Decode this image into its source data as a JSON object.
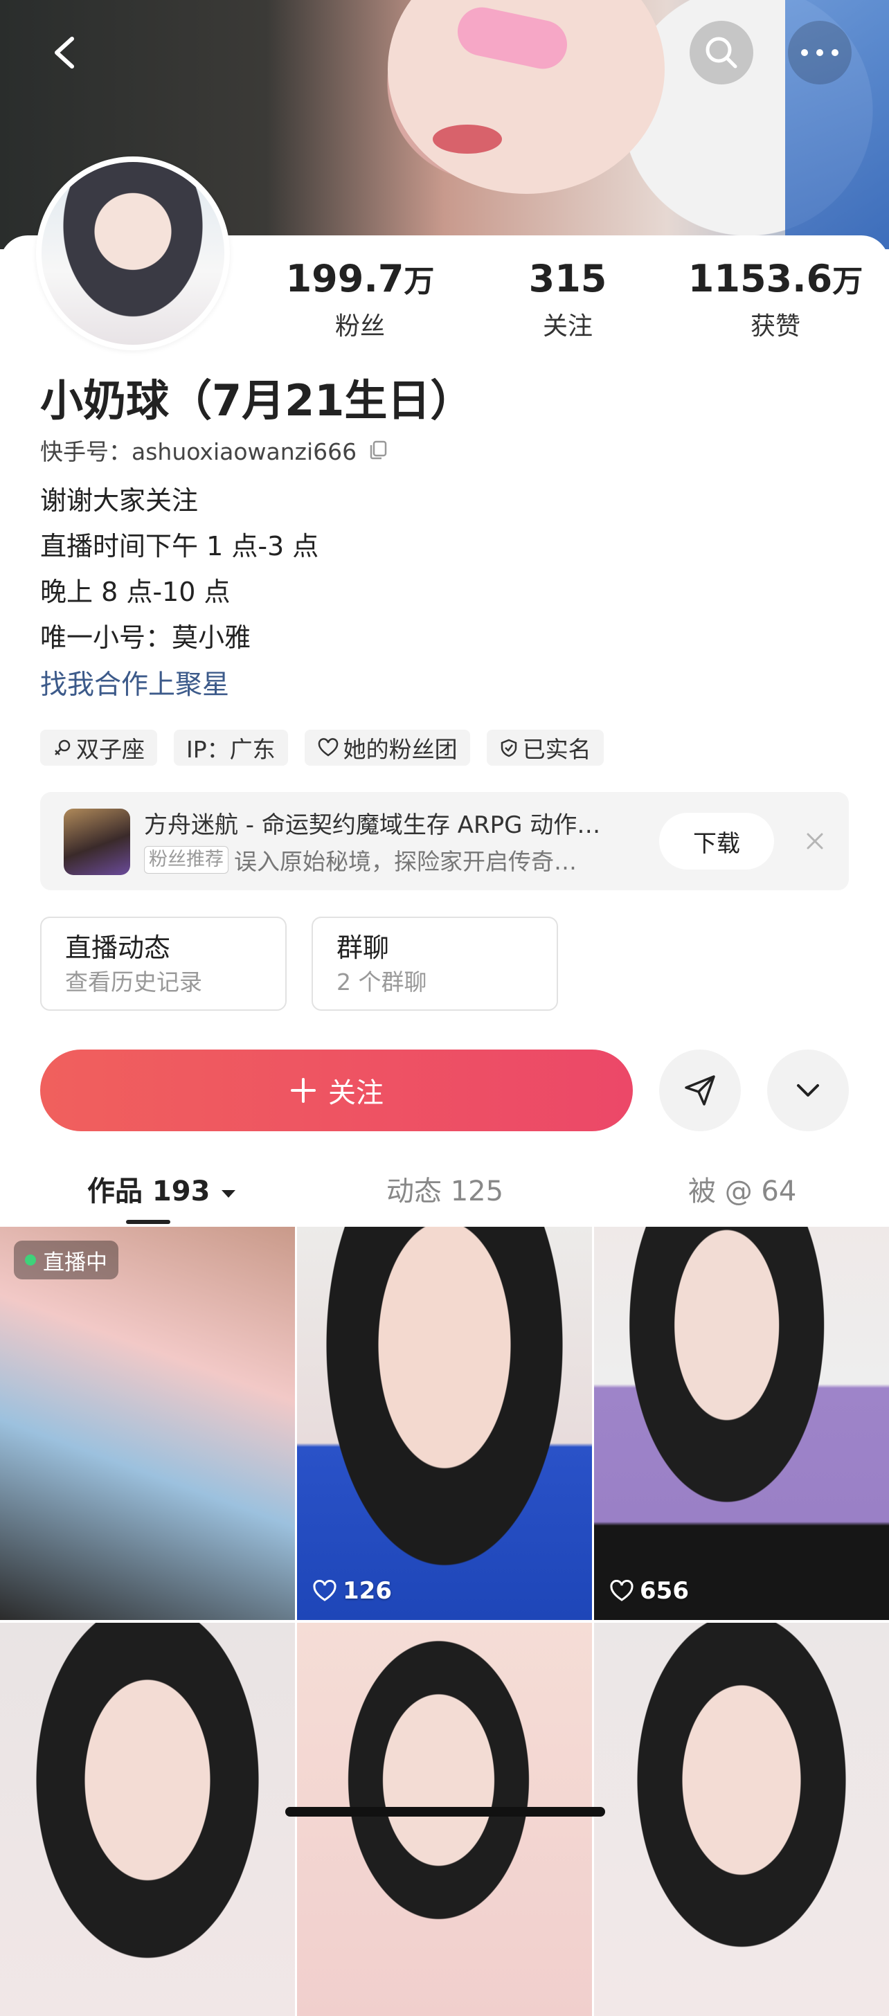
{
  "header": {
    "back_icon": "chevron-left-icon",
    "search_icon": "search-icon",
    "more_icon": "more-dots-icon"
  },
  "profile": {
    "stats": [
      {
        "num": "199.7",
        "unit": "万",
        "label": "粉丝"
      },
      {
        "num": "315",
        "unit": "",
        "label": "关注"
      },
      {
        "num": "1153.6",
        "unit": "万",
        "label": "获赞"
      }
    ],
    "name": "小奶球（7月21生日）",
    "kuaishou_id": "快手号：ashuoxiaowanzi666",
    "bio": [
      "谢谢大家关注",
      "直播时间下午 1 点-3 点",
      "晚上 8 点-10 点",
      "唯一小号：莫小雅"
    ],
    "coop_link": "找我合作上聚星",
    "tags": [
      "双子座",
      "IP：广东",
      "她的粉丝团",
      "已实名"
    ]
  },
  "ad": {
    "title": "方舟迷航 - 命运契约魔域生存 ARPG 动作…",
    "badge": "粉丝推荐",
    "subtitle": "误入原始秘境，探险家开启传奇…",
    "download": "下载"
  },
  "boxes": [
    {
      "title": "直播动态",
      "sub": "查看历史记录"
    },
    {
      "title": "群聊",
      "sub": "2 个群聊"
    }
  ],
  "actions": {
    "follow": "关注"
  },
  "tabs": [
    "作品 193",
    "动态 125",
    "被 @ 64"
  ],
  "grid": {
    "live_label": "直播中",
    "likes": [
      "126",
      "656"
    ]
  },
  "colors": {
    "accent": "#ec4868",
    "link": "#3c5a8a"
  }
}
